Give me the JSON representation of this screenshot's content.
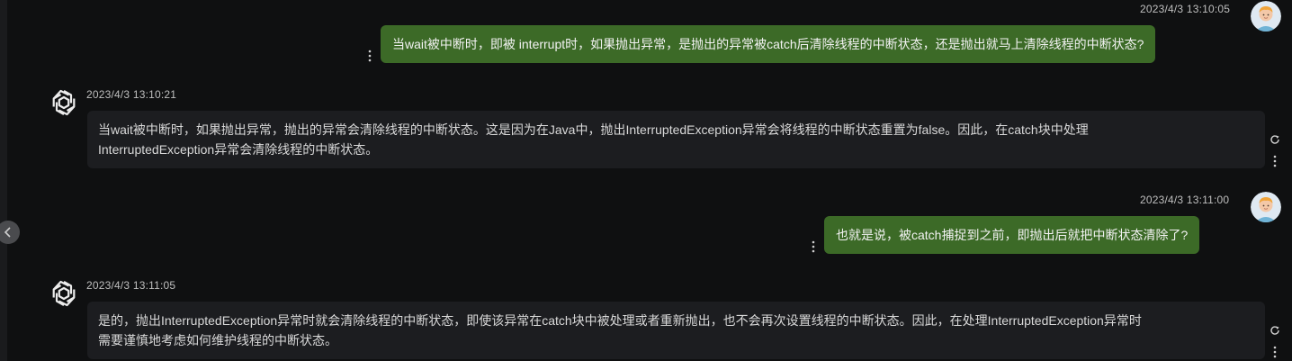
{
  "messages": [
    {
      "role": "user",
      "timestamp": "2023/4/3 13:10:05",
      "text": "当wait被中断时，即被 interrupt时，如果抛出异常，是抛出的异常被catch后清除线程的中断状态，还是抛出就马上清除线程的中断状态?"
    },
    {
      "role": "assistant",
      "timestamp": "2023/4/3 13:10:21",
      "lines": [
        "当wait被中断时，如果抛出异常，抛出的异常会清除线程的中断状态。这是因为在Java中，抛出InterruptedException异常会将线程的中断状态重置为false。因此，在catch块中处理",
        "InterruptedException异常会清除线程的中断状态。"
      ]
    },
    {
      "role": "user",
      "timestamp": "2023/4/3 13:11:00",
      "text": "也就是说，被catch捕捉到之前，即抛出后就把中断状态清除了?"
    },
    {
      "role": "assistant",
      "timestamp": "2023/4/3 13:11:05",
      "lines": [
        "是的，抛出InterruptedException异常时就会清除线程的中断状态，即使该异常在catch块中被处理或者重新抛出，也不会再次设置线程的中断状态。因此，在处理InterruptedException异常时",
        "需要谨慎地考虑如何维护线程的中断状态。"
      ]
    }
  ],
  "icons": {
    "collapse": "chevron-left-icon",
    "more": "more-vertical-icon",
    "regenerate": "refresh-icon",
    "assistant_avatar": "openai-logo-icon",
    "user_avatar": "user-avatar-icon"
  },
  "colors": {
    "background": "#0f1011",
    "user_bubble": "#3c6a27",
    "assistant_bubble": "#1c1d20",
    "text": "#d9d9d9"
  }
}
